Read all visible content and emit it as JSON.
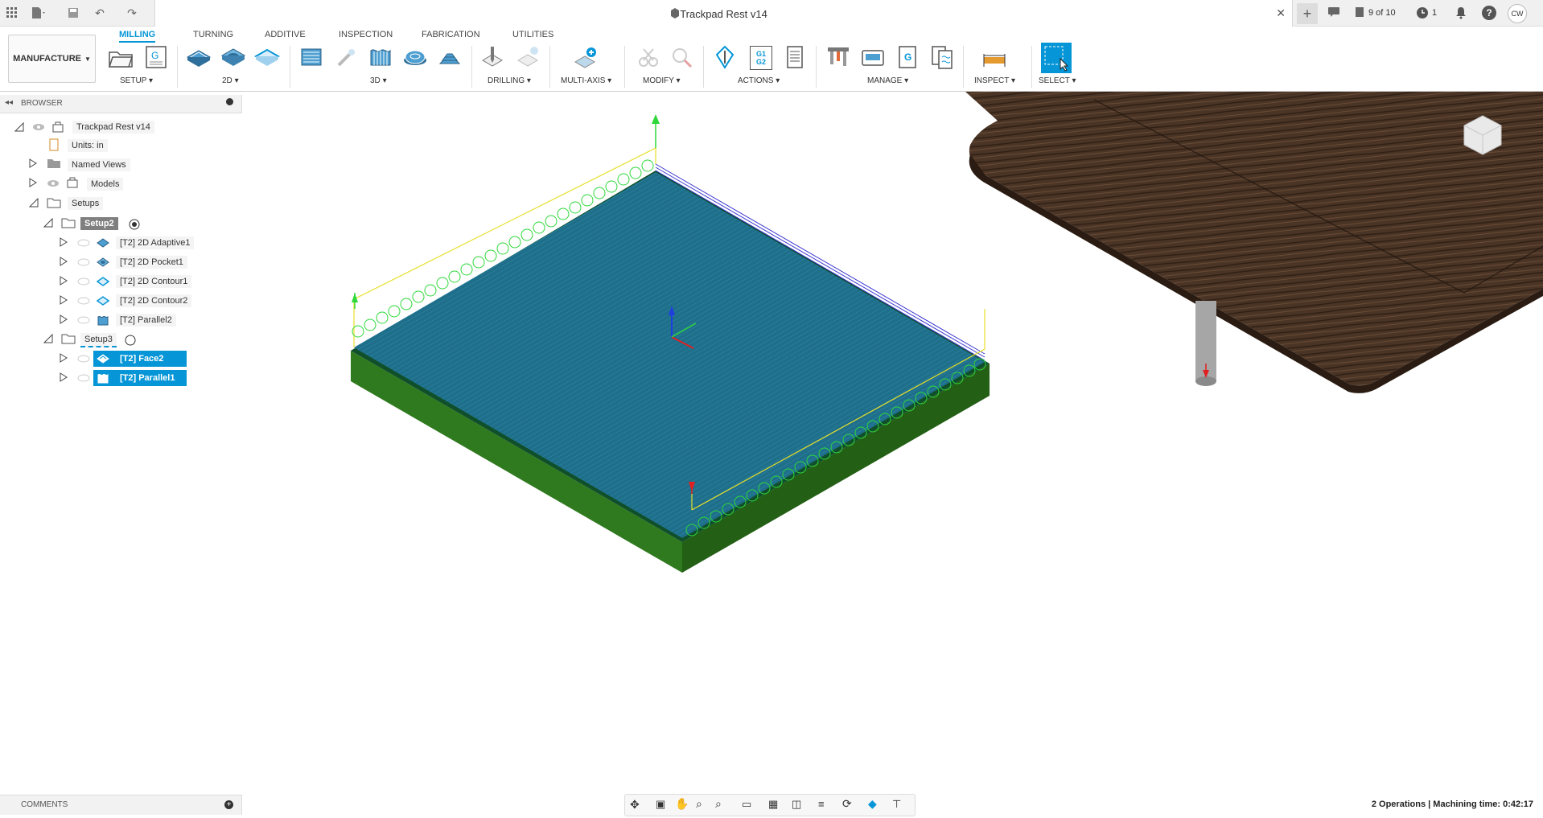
{
  "titlebar": {
    "doc_title": "Trackpad Rest v14",
    "job_counter": "9 of 10",
    "clock_count": "1",
    "user_initials": "CW"
  },
  "ribbon": {
    "workspace": "MANUFACTURE",
    "tabs": [
      "MILLING",
      "TURNING",
      "ADDITIVE",
      "INSPECTION",
      "FABRICATION",
      "UTILITIES"
    ],
    "groups": [
      "SETUP",
      "2D",
      "3D",
      "DRILLING",
      "MULTI-AXIS",
      "MODIFY",
      "ACTIONS",
      "MANAGE",
      "INSPECT",
      "SELECT"
    ],
    "actions_g_label": "G1 G2",
    "manage_g_label": "G"
  },
  "browser": {
    "title": "BROWSER",
    "root": "Trackpad Rest v14",
    "units": "Units: in",
    "named_views": "Named Views",
    "models": "Models",
    "setups": "Setups",
    "setup2": "Setup2",
    "setup2_ops": [
      "[T2] 2D Adaptive1",
      "[T2] 2D Pocket1",
      "[T2] 2D Contour1",
      "[T2] 2D Contour2",
      "[T2] Parallel2"
    ],
    "setup3": "Setup3",
    "setup3_ops": [
      "[T2] Face2",
      "[T2] Parallel1"
    ]
  },
  "comments": "COMMENTS",
  "status": "2 Operations | Machining time: 0:42:17",
  "colors": {
    "accent": "#0696d7",
    "stock": "#2f7a1e",
    "toolpath": "#1f6f8b",
    "wood": "#4a3425"
  }
}
